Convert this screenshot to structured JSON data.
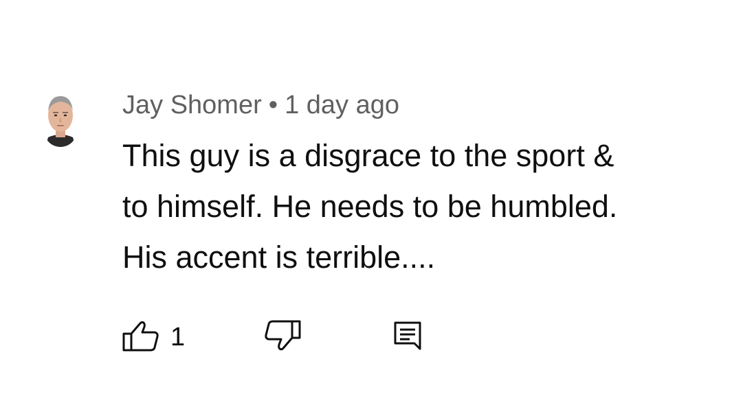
{
  "comment": {
    "author": "Jay Shomer",
    "separator": "•",
    "timestamp": "1 day ago",
    "text_lines": [
      "This guy is a disgrace to the sport &",
      "to himself. He needs to be humbled.",
      "His accent is terrible...."
    ],
    "like_count": "1"
  },
  "icons": {
    "like": "thumbs-up-icon",
    "dislike": "thumbs-down-icon",
    "reply": "comment-reply-icon"
  },
  "colors": {
    "text_primary": "#0f0f0f",
    "text_secondary": "#606060",
    "background": "#ffffff"
  }
}
